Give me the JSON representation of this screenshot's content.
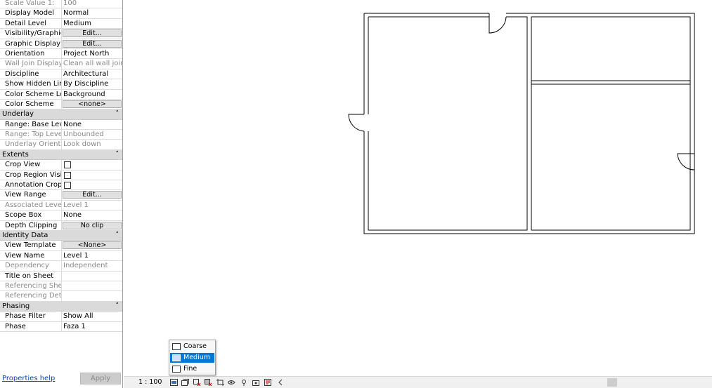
{
  "properties": {
    "rows1": [
      {
        "name": "Scale Value   1:",
        "value": "100",
        "disabled": true
      },
      {
        "name": "Display Model",
        "value": "Normal"
      },
      {
        "name": "Detail Level",
        "value": "Medium"
      },
      {
        "name": "Visibility/Graphic...",
        "button": "Edit..."
      },
      {
        "name": "Graphic Display ...",
        "button": "Edit..."
      },
      {
        "name": "Orientation",
        "value": "Project North"
      },
      {
        "name": "Wall Join Display",
        "value": "Clean all wall joins",
        "disabled": true
      },
      {
        "name": "Discipline",
        "value": "Architectural"
      },
      {
        "name": "Show Hidden Lin...",
        "value": "By Discipline"
      },
      {
        "name": "Color Scheme Lo...",
        "value": "Background"
      },
      {
        "name": "Color Scheme",
        "button": "<none>"
      }
    ],
    "underlay": {
      "title": "Underlay",
      "rows": [
        {
          "name": "Range: Base Level",
          "value": "None"
        },
        {
          "name": "Range: Top Level",
          "value": "Unbounded",
          "disabled": true
        },
        {
          "name": "Underlay Orienta...",
          "value": "Look down",
          "disabled": true
        }
      ]
    },
    "extents": {
      "title": "Extents",
      "rows": [
        {
          "name": "Crop View",
          "checkbox": true
        },
        {
          "name": "Crop Region Visi...",
          "checkbox": true
        },
        {
          "name": "Annotation Crop",
          "checkbox": true
        },
        {
          "name": "View Range",
          "button": "Edit..."
        },
        {
          "name": "Associated Level",
          "value": "Level 1",
          "disabled": true
        },
        {
          "name": "Scope Box",
          "value": "None"
        },
        {
          "name": "Depth Clipping",
          "button": "No clip"
        }
      ]
    },
    "identity": {
      "title": "Identity Data",
      "rows": [
        {
          "name": "View Template",
          "button": "<None>"
        },
        {
          "name": "View Name",
          "value": "Level 1"
        },
        {
          "name": "Dependency",
          "value": "Independent",
          "disabled": true
        },
        {
          "name": "Title on Sheet",
          "value": ""
        },
        {
          "name": "Referencing Sheet",
          "value": "",
          "disabled": true
        },
        {
          "name": "Referencing Detail",
          "value": "",
          "disabled": true
        }
      ]
    },
    "phasing": {
      "title": "Phasing",
      "rows": [
        {
          "name": "Phase Filter",
          "value": "Show All"
        },
        {
          "name": "Phase",
          "value": "Faza 1"
        }
      ]
    },
    "collapse_glyph": "˄",
    "help_link": "Properties help",
    "apply_label": "Apply"
  },
  "statusbar": {
    "scale": "1 : 100"
  },
  "detail_menu": {
    "items": [
      {
        "label": "Coarse",
        "selected": false
      },
      {
        "label": "Medium",
        "selected": true
      },
      {
        "label": "Fine",
        "selected": false
      }
    ]
  }
}
